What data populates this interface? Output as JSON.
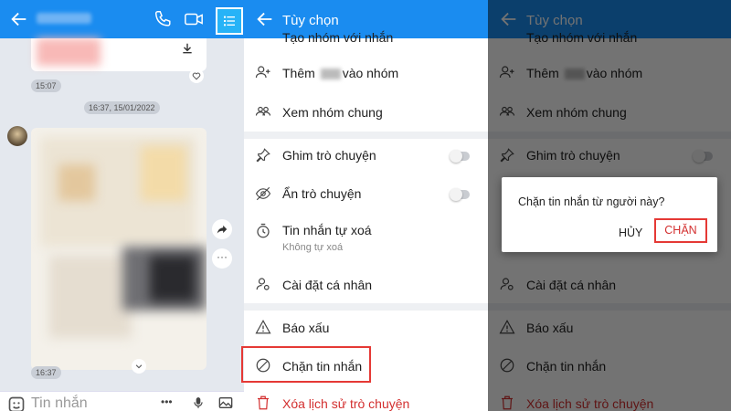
{
  "chat": {
    "time_top": "15:07",
    "date_divider": "16:37, 15/01/2022",
    "time_bottom": "16:37",
    "input_placeholder": "Tin nhắn",
    "more_glyph": "•••"
  },
  "options": {
    "title": "Tùy chọn",
    "partial_top": "Tạo nhóm với nhắn",
    "add_to_group_prefix": "Thêm",
    "add_to_group_suffix": "vào nhóm",
    "common_groups": "Xem nhóm chung",
    "pin_chat": "Ghim trò chuyện",
    "hide_chat": "Ẩn trò chuyện",
    "auto_delete": "Tin nhắn tự xoá",
    "auto_delete_sub": "Không tự xoá",
    "personal_settings": "Cài đặt cá nhân",
    "report": "Báo xấu",
    "block": "Chặn tin nhắn",
    "delete_history": "Xóa lịch sử trò chuyện"
  },
  "dialog": {
    "message": "Chặn tin nhắn từ người này?",
    "cancel": "HỦY",
    "confirm": "CHẶN"
  },
  "colors": {
    "header_blue": "#1a8cf0",
    "danger_red": "#d32f2f",
    "highlight_red": "#e53935"
  },
  "icons": [
    "back-icon",
    "phone-icon",
    "video-call-icon",
    "options-list-icon",
    "download-icon",
    "heart-icon",
    "forward-icon",
    "chevron-down-icon",
    "emoji-icon",
    "microphone-icon",
    "image-icon",
    "add-user-icon",
    "group-icon",
    "pin-icon",
    "hide-eye-icon",
    "timer-icon",
    "user-settings-icon",
    "warning-icon",
    "block-icon",
    "trash-icon"
  ]
}
